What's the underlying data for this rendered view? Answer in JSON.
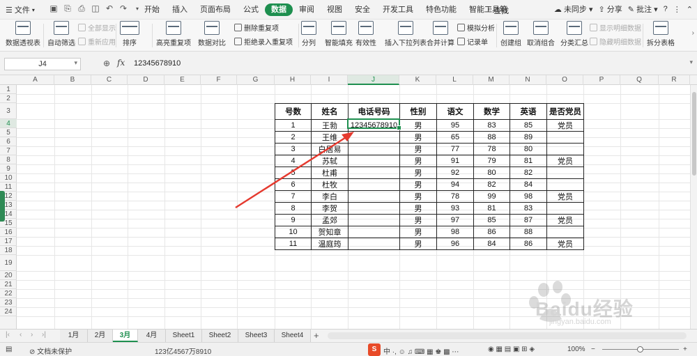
{
  "menubar": {
    "file_label": "文件",
    "tabs": [
      "开始",
      "插入",
      "页面布局",
      "公式",
      "数据",
      "审阅",
      "视图",
      "安全",
      "开发工具",
      "特色功能",
      "智能工具箱"
    ],
    "active_tab": "数据",
    "search_label": "查找",
    "sync_label": "未同步",
    "share_label": "分享",
    "annotate_label": "批注"
  },
  "ribbon": {
    "pivot": "数据透视表",
    "autofilter": "自动筛选",
    "show_all": "全部显示",
    "reapply": "重新应用",
    "sort": "排序",
    "highlight_dup": "高亮重复项",
    "compare": "数据对比",
    "delete_dup": "删除重复项",
    "reject_dup": "拒绝录入重复项",
    "split": "分列",
    "smart_fill": "智能填充",
    "validity": "有效性",
    "insert_dropdown": "插入下拉列表",
    "merge_calc": "合并计算",
    "simulate": "模拟分析",
    "record": "记录单",
    "create_group": "创建组",
    "ungroup": "取消组合",
    "subtotal": "分类汇总",
    "show_detail": "显示明细数据",
    "hide_detail": "隐藏明细数据",
    "split_table": "拆分表格"
  },
  "formula_bar": {
    "cell_ref": "J4",
    "fx": "fx",
    "value": "12345678910"
  },
  "grid": {
    "columns": [
      "A",
      "B",
      "C",
      "D",
      "E",
      "F",
      "G",
      "H",
      "I",
      "J",
      "K",
      "L",
      "M",
      "N",
      "O",
      "P",
      "Q",
      "R"
    ],
    "selected_column": "J",
    "rows": [
      "1",
      "2",
      "3",
      "4",
      "5",
      "6",
      "7",
      "8",
      "9",
      "10",
      "11",
      "12",
      "13",
      "14",
      "15",
      "16",
      "17",
      "18",
      "19",
      "20",
      "21",
      "22",
      "23",
      "24"
    ],
    "selected_row": "4"
  },
  "table": {
    "headers": [
      "号数",
      "姓名",
      "电话号码",
      "性别",
      "语文",
      "数学",
      "英语",
      "是否党员"
    ],
    "rows": [
      [
        "1",
        "王勃",
        "12345678910",
        "男",
        "95",
        "83",
        "85",
        "党员"
      ],
      [
        "2",
        "王维",
        "",
        "男",
        "65",
        "88",
        "89",
        ""
      ],
      [
        "3",
        "白居易",
        "",
        "男",
        "77",
        "78",
        "80",
        ""
      ],
      [
        "4",
        "苏轼",
        "",
        "男",
        "91",
        "79",
        "81",
        "党员"
      ],
      [
        "5",
        "杜甫",
        "",
        "男",
        "92",
        "80",
        "82",
        ""
      ],
      [
        "6",
        "杜牧",
        "",
        "男",
        "94",
        "82",
        "84",
        ""
      ],
      [
        "7",
        "李白",
        "",
        "男",
        "78",
        "99",
        "98",
        "党员"
      ],
      [
        "8",
        "李贺",
        "",
        "男",
        "93",
        "81",
        "83",
        ""
      ],
      [
        "9",
        "孟郊",
        "",
        "男",
        "97",
        "85",
        "87",
        "党员"
      ],
      [
        "10",
        "贺知章",
        "",
        "男",
        "98",
        "86",
        "88",
        ""
      ],
      [
        "11",
        "温庭筠",
        "",
        "男",
        "96",
        "84",
        "86",
        "党员"
      ]
    ]
  },
  "sheets": [
    "1月",
    "2月",
    "3月",
    "4月",
    "Sheet1",
    "Sheet2",
    "Sheet3",
    "Sheet4"
  ],
  "active_sheet": "3月",
  "statusbar": {
    "protect": "文档未保护",
    "cell_value_readout": "123亿4567万8910",
    "zoom": "100%"
  },
  "watermark": {
    "brand": "Baidu经验",
    "url": "jingyan.baidu.com"
  },
  "colors": {
    "accent": "#1e8f4f",
    "arrow": "#e53a2f"
  }
}
